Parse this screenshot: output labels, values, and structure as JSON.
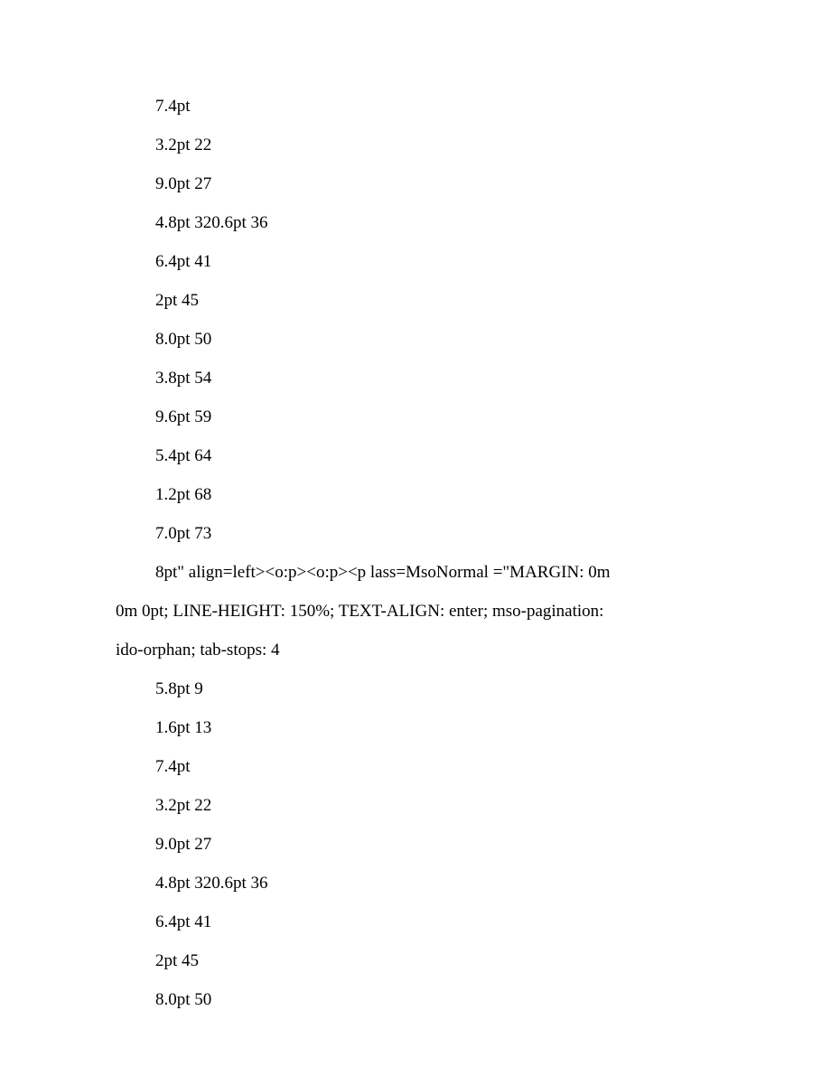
{
  "lines": [
    {
      "text": "7.4pt",
      "indent": true
    },
    {
      "text": "3.2pt 22",
      "indent": true
    },
    {
      "text": "9.0pt 27",
      "indent": true
    },
    {
      "text": "4.8pt 320.6pt 36",
      "indent": true
    },
    {
      "text": "6.4pt 41",
      "indent": true
    },
    {
      "text": "2pt 45",
      "indent": true
    },
    {
      "text": "8.0pt 50",
      "indent": true
    },
    {
      "text": "3.8pt 54",
      "indent": true
    },
    {
      "text": "9.6pt 59",
      "indent": true
    },
    {
      "text": "5.4pt 64",
      "indent": true
    },
    {
      "text": "1.2pt 68",
      "indent": true
    },
    {
      "text": "7.0pt 73",
      "indent": true
    },
    {
      "text": "8pt\" align=left><o:p><o:p><p lass=MsoNormal =\"MARGIN: 0m",
      "indent": true
    },
    {
      "text": "0m 0pt; LINE-HEIGHT: 150%; TEXT-ALIGN: enter; mso-pagination:",
      "indent": false
    },
    {
      "text": "ido-orphan; tab-stops: 4",
      "indent": false
    },
    {
      "text": "5.8pt 9",
      "indent": true
    },
    {
      "text": "1.6pt 13",
      "indent": true
    },
    {
      "text": "7.4pt",
      "indent": true
    },
    {
      "text": "3.2pt 22",
      "indent": true
    },
    {
      "text": "9.0pt 27",
      "indent": true
    },
    {
      "text": "4.8pt 320.6pt 36",
      "indent": true
    },
    {
      "text": "6.4pt 41",
      "indent": true
    },
    {
      "text": "2pt 45",
      "indent": true
    },
    {
      "text": "8.0pt 50",
      "indent": true
    }
  ]
}
